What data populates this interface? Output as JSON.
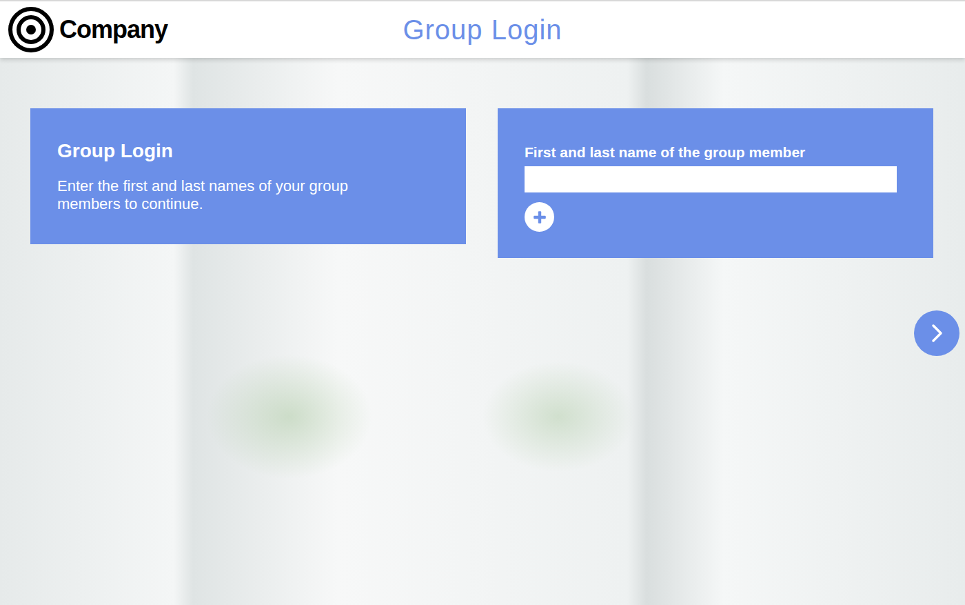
{
  "header": {
    "logo_text": "Company",
    "title": "Group Login"
  },
  "intro": {
    "heading": "Group Login",
    "text": "Enter the first and last names of your group members to continue."
  },
  "members": {
    "label": "First and last name of the group member"
  }
}
